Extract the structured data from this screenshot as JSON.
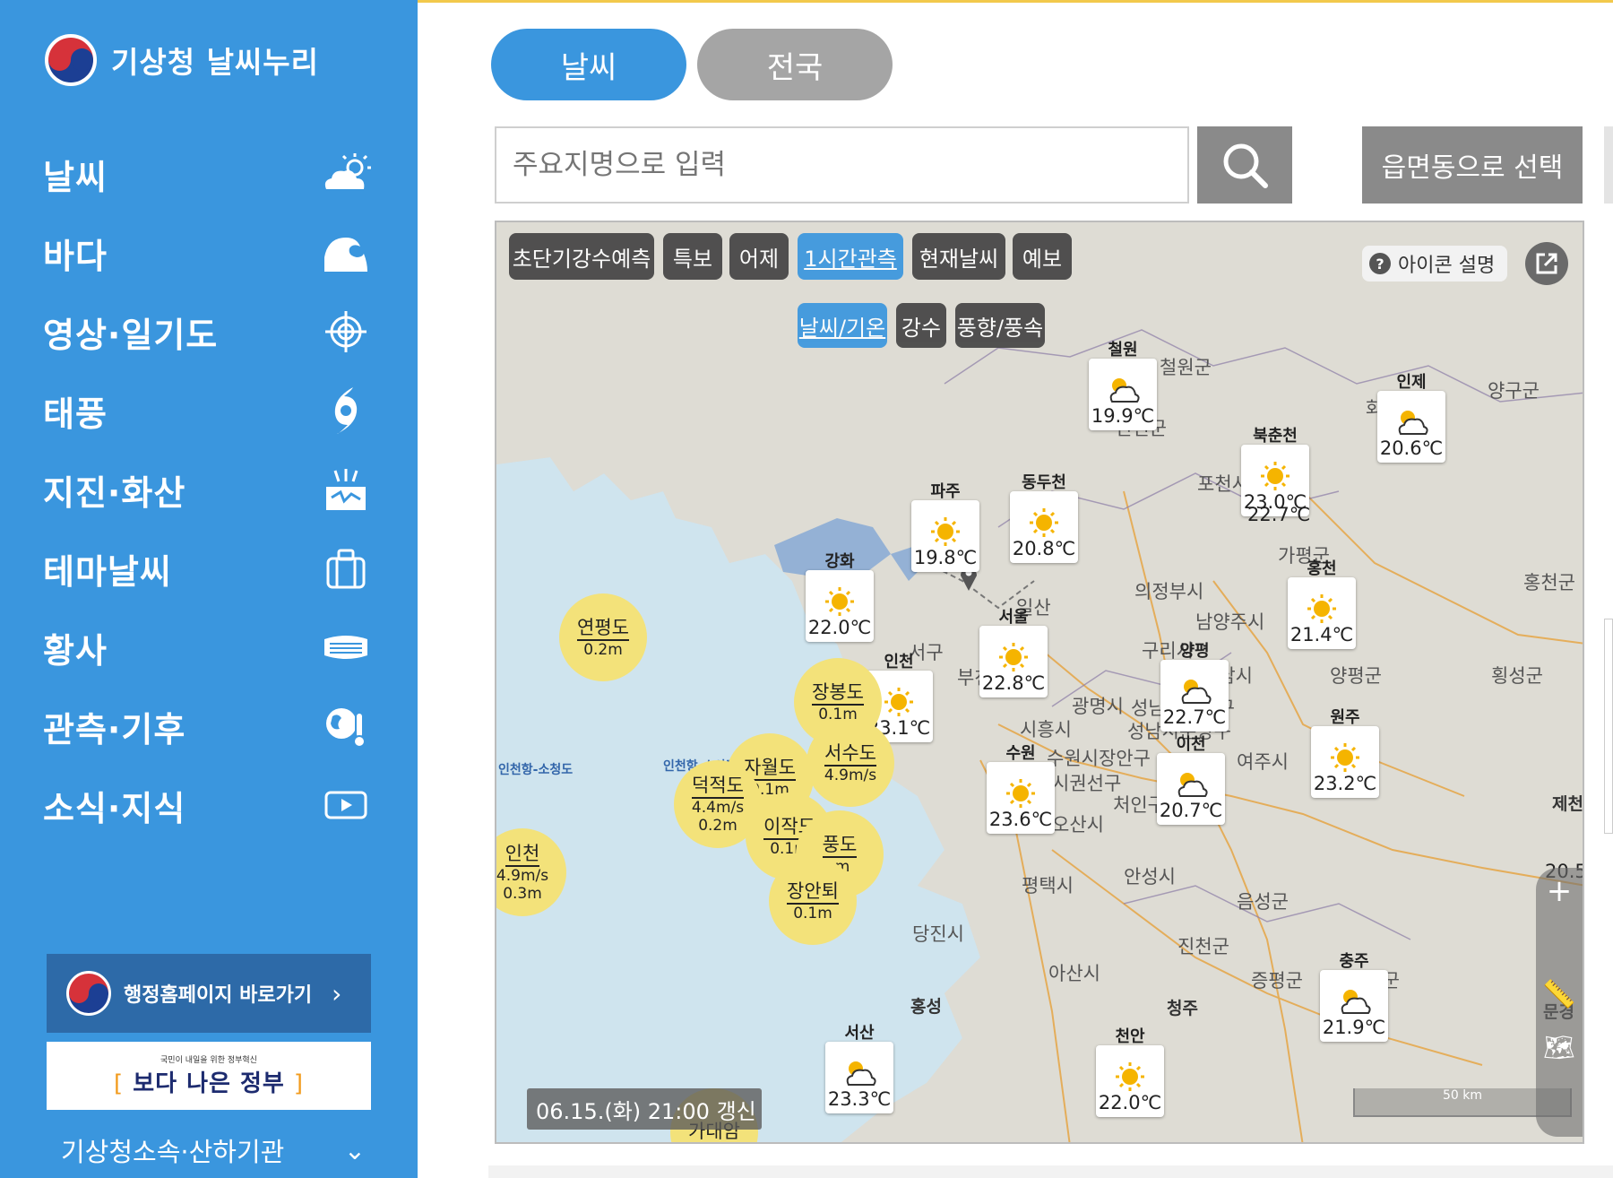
{
  "sidebar": {
    "logo_text": "기상청 날씨누리",
    "items": [
      {
        "label": "날씨",
        "icon": "weather-cloud-sun-icon"
      },
      {
        "label": "바다",
        "icon": "wave-icon"
      },
      {
        "label": "영상·일기도",
        "icon": "satellite-target-icon"
      },
      {
        "label": "태풍",
        "icon": "typhoon-icon"
      },
      {
        "label": "지진·화산",
        "icon": "earthquake-volcano-icon"
      },
      {
        "label": "테마날씨",
        "icon": "suitcase-icon"
      },
      {
        "label": "황사",
        "icon": "mask-icon"
      },
      {
        "label": "관측·기후",
        "icon": "globe-thermometer-icon"
      },
      {
        "label": "소식·지식",
        "icon": "play-video-icon"
      }
    ],
    "gov_button": "행정홈페이지 바로가기",
    "better_gov_small": "국민이 내일을 위한 정부혁신",
    "better_gov": "보다 나은 정부",
    "affiliates": "기상청소속·산하기관"
  },
  "tabs": {
    "weather": "날씨",
    "national": "전국"
  },
  "search": {
    "placeholder": "주요지명으로 입력",
    "select_label": "읍면동으로 선택"
  },
  "map": {
    "layer_chips": [
      "초단기강수예측",
      "특보",
      "어제",
      "1시간관측",
      "현재날씨",
      "예보"
    ],
    "active_layer": "1시간관측",
    "sub_chips": [
      "날씨/기온",
      "강수",
      "풍향/풍속"
    ],
    "active_sub": "날씨/기온",
    "icon_help": "아이콘 설명",
    "timestamp": "06.15.(화) 21:00 갱신",
    "scale": "50 km",
    "stations": [
      {
        "name": "철원",
        "temp": "19.9℃",
        "icon": "partly-cloudy"
      },
      {
        "name": "인제",
        "temp": "20.6℃",
        "icon": "partly-cloudy"
      },
      {
        "name": "북춘천",
        "temp": "23.0℃",
        "icon": "sunny"
      },
      {
        "name": "",
        "temp": "22.7℃",
        "icon": ""
      },
      {
        "name": "파주",
        "temp": "19.8℃",
        "icon": "sunny"
      },
      {
        "name": "동두천",
        "temp": "20.8℃",
        "icon": "sunny"
      },
      {
        "name": "강화",
        "temp": "22.0℃",
        "icon": "sunny"
      },
      {
        "name": "홍천",
        "temp": "21.4℃",
        "icon": "sunny"
      },
      {
        "name": "서울",
        "temp": "22.8℃",
        "icon": "sunny"
      },
      {
        "name": "양평",
        "temp": "22.7℃",
        "icon": "partly-cloudy"
      },
      {
        "name": "인천",
        "temp": "23.1℃",
        "icon": "sunny"
      },
      {
        "name": "원주",
        "temp": "23.2℃",
        "icon": "sunny"
      },
      {
        "name": "수원",
        "temp": "23.6℃",
        "icon": "sunny"
      },
      {
        "name": "이천",
        "temp": "20.7℃",
        "icon": "partly-cloudy"
      },
      {
        "name": "충주",
        "temp": "21.9℃",
        "icon": "partly-cloudy"
      },
      {
        "name": "서산",
        "temp": "23.3℃",
        "icon": "partly-cloudy"
      },
      {
        "name": "천안",
        "temp": "22.0℃",
        "icon": "sunny"
      },
      {
        "name": "제천",
        "temp": "20.5",
        "icon": "sunny"
      }
    ],
    "sea_points": [
      {
        "name": "연평도",
        "value": "0.2m"
      },
      {
        "name": "장봉도",
        "value": "0.1m"
      },
      {
        "name": "자월도",
        "value": "0.1m"
      },
      {
        "name": "서수도",
        "value": "4.9m/s"
      },
      {
        "name": "덕적도",
        "value": "4.4m/s",
        "value2": "0.2m"
      },
      {
        "name": "이작도",
        "value": "0.1m"
      },
      {
        "name": "풍도",
        "value": "-m"
      },
      {
        "name": "인천",
        "value": "4.9m/s",
        "value2": "0.3m"
      },
      {
        "name": "장안퇴",
        "value": "0.1m"
      },
      {
        "name": "가대암",
        "value": ""
      }
    ],
    "place_labels": [
      "철원군",
      "양구군",
      "화천군",
      "연천군",
      "포천시",
      "가평군",
      "홍천군",
      "의정부시",
      "남양주시",
      "일산",
      "구리시",
      "하남시",
      "양평군",
      "횡성군",
      "광명시",
      "시흥시",
      "성남시수정구",
      "성남시분당구",
      "수원시장안구",
      "시권선구",
      "처인구",
      "여주시",
      "오산시",
      "안성시",
      "평택시",
      "음성군",
      "진천군",
      "당진시",
      "아산시",
      "홍성",
      "증평군",
      "괴산군",
      "청주",
      "문경",
      "서구",
      "부천"
    ],
    "routes": [
      "인천항-소청도",
      "인천항-소야평"
    ]
  },
  "colors": {
    "sidebar": "#3a96de",
    "sea": "#cfe4ee",
    "land": "#dcdad3",
    "sea_marker": "#f3e27a"
  }
}
